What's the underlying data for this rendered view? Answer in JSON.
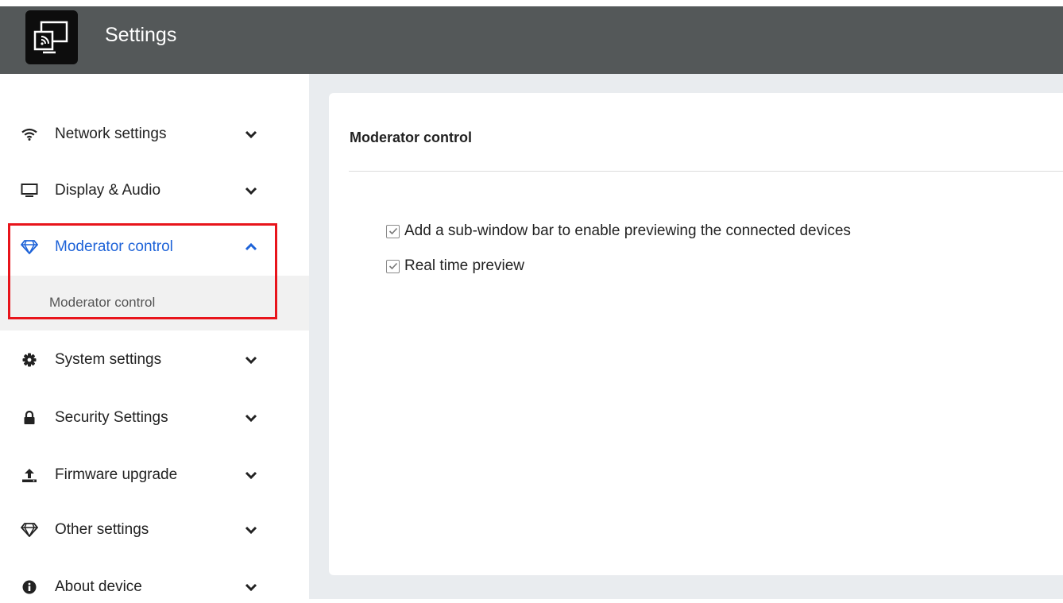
{
  "header": {
    "title": "Settings",
    "app_icon": "screen-cast-icon"
  },
  "sidebar": {
    "items": [
      {
        "label": "Network settings",
        "icon": "wifi-icon",
        "expanded": false
      },
      {
        "label": "Display & Audio",
        "icon": "monitor-icon",
        "expanded": false
      },
      {
        "label": "Moderator control",
        "icon": "diamond-icon",
        "expanded": true,
        "active": true,
        "subitems": [
          {
            "label": "Moderator control"
          }
        ]
      },
      {
        "label": "System settings",
        "icon": "gear-icon",
        "expanded": false
      },
      {
        "label": "Security Settings",
        "icon": "lock-icon",
        "expanded": false
      },
      {
        "label": "Firmware upgrade",
        "icon": "upload-icon",
        "expanded": false
      },
      {
        "label": "Other settings",
        "icon": "diamond-icon",
        "expanded": false
      },
      {
        "label": "About device",
        "icon": "info-icon",
        "expanded": false
      }
    ]
  },
  "main": {
    "title": "Moderator control",
    "options": [
      {
        "label": "Add a sub-window bar to enable previewing the connected devices",
        "checked": true
      },
      {
        "label": "Real time preview",
        "checked": true
      }
    ]
  },
  "colors": {
    "header_bg": "#545859",
    "accent": "#1e63d8",
    "highlight_border": "#e8141b",
    "main_bg": "#e9ecef"
  }
}
